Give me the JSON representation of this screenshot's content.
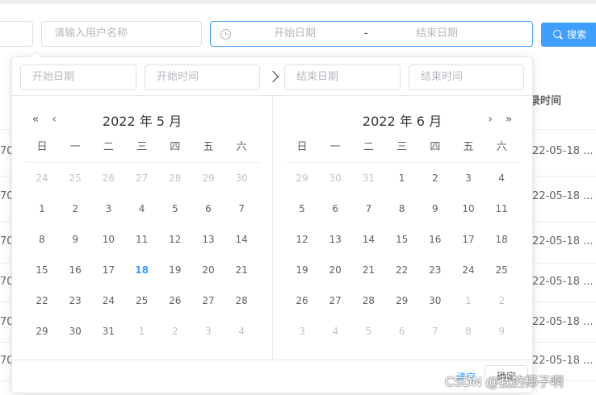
{
  "filters": {
    "username_placeholder": "请输入用户名称",
    "start_date_placeholder": "开始日期",
    "range_separator": "-",
    "end_date_placeholder": "结束日期",
    "search_label": "搜索"
  },
  "table": {
    "col_login_time": "录时间",
    "rows": [
      {
        "left": "70",
        "time": "22-05-18 ..."
      },
      {
        "left": "70",
        "time": "22-05-18 ..."
      },
      {
        "left": "70",
        "time": "22-05-18 ..."
      },
      {
        "left": "70",
        "time": "22-05-18 ..."
      },
      {
        "left": "70",
        "time": "22-05-18 ..."
      },
      {
        "left": "70",
        "time": "22-05-18 ..."
      }
    ]
  },
  "picker": {
    "start_date_placeholder": "开始日期",
    "start_time_placeholder": "开始时间",
    "end_date_placeholder": "结束日期",
    "end_time_placeholder": "结束时间",
    "weekdays": [
      "日",
      "一",
      "二",
      "三",
      "四",
      "五",
      "六"
    ],
    "left": {
      "title": "2022 年 5 月",
      "weeks": [
        [
          [
            "24",
            1
          ],
          [
            "25",
            1
          ],
          [
            "26",
            1
          ],
          [
            "27",
            1
          ],
          [
            "28",
            1
          ],
          [
            "29",
            1
          ],
          [
            "30",
            1
          ]
        ],
        [
          [
            "1",
            0
          ],
          [
            "2",
            0
          ],
          [
            "3",
            0
          ],
          [
            "4",
            0
          ],
          [
            "5",
            0
          ],
          [
            "6",
            0
          ],
          [
            "7",
            0
          ]
        ],
        [
          [
            "8",
            0
          ],
          [
            "9",
            0
          ],
          [
            "10",
            0
          ],
          [
            "11",
            0
          ],
          [
            "12",
            0
          ],
          [
            "13",
            0
          ],
          [
            "14",
            0
          ]
        ],
        [
          [
            "15",
            0
          ],
          [
            "16",
            0
          ],
          [
            "17",
            0
          ],
          [
            "18",
            2
          ],
          [
            "19",
            0
          ],
          [
            "20",
            0
          ],
          [
            "21",
            0
          ]
        ],
        [
          [
            "22",
            0
          ],
          [
            "23",
            0
          ],
          [
            "24",
            0
          ],
          [
            "25",
            0
          ],
          [
            "26",
            0
          ],
          [
            "27",
            0
          ],
          [
            "28",
            0
          ]
        ],
        [
          [
            "29",
            0
          ],
          [
            "30",
            0
          ],
          [
            "31",
            0
          ],
          [
            "1",
            1
          ],
          [
            "2",
            1
          ],
          [
            "3",
            1
          ],
          [
            "4",
            1
          ]
        ]
      ]
    },
    "right": {
      "title": "2022 年 6 月",
      "weeks": [
        [
          [
            "29",
            1
          ],
          [
            "30",
            1
          ],
          [
            "31",
            1
          ],
          [
            "1",
            0
          ],
          [
            "2",
            0
          ],
          [
            "3",
            0
          ],
          [
            "4",
            0
          ]
        ],
        [
          [
            "5",
            0
          ],
          [
            "6",
            0
          ],
          [
            "7",
            0
          ],
          [
            "8",
            0
          ],
          [
            "9",
            0
          ],
          [
            "10",
            0
          ],
          [
            "11",
            0
          ]
        ],
        [
          [
            "12",
            0
          ],
          [
            "13",
            0
          ],
          [
            "14",
            0
          ],
          [
            "15",
            0
          ],
          [
            "16",
            0
          ],
          [
            "17",
            0
          ],
          [
            "18",
            0
          ]
        ],
        [
          [
            "19",
            0
          ],
          [
            "20",
            0
          ],
          [
            "21",
            0
          ],
          [
            "22",
            0
          ],
          [
            "23",
            0
          ],
          [
            "24",
            0
          ],
          [
            "25",
            0
          ]
        ],
        [
          [
            "26",
            0
          ],
          [
            "27",
            0
          ],
          [
            "28",
            0
          ],
          [
            "29",
            0
          ],
          [
            "30",
            0
          ],
          [
            "1",
            1
          ],
          [
            "2",
            1
          ]
        ],
        [
          [
            "3",
            1
          ],
          [
            "4",
            1
          ],
          [
            "5",
            1
          ],
          [
            "6",
            1
          ],
          [
            "7",
            1
          ],
          [
            "8",
            1
          ],
          [
            "9",
            1
          ]
        ]
      ]
    },
    "clear_label": "清空",
    "ok_label": "确定"
  },
  "watermark": "CSDN @我的椰子啊",
  "colors": {
    "accent": "#409eff",
    "muted": "#c0c4cc",
    "text": "#606266"
  }
}
